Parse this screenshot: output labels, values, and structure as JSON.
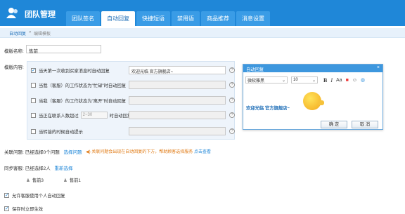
{
  "header": {
    "app_title": "团队管理",
    "tabs": [
      "团队签名",
      "自动回复",
      "快捷短语",
      "禁用语",
      "商品推荐",
      "消息设置"
    ],
    "active_tab": "自动回复"
  },
  "breadcrumb": {
    "root": "自动回复",
    "separator": "»",
    "current": "编辑模板"
  },
  "form": {
    "template_name_label": "模版名称:",
    "template_name_value": "售前",
    "content_label": "模版内容:"
  },
  "rules": [
    {
      "checked": true,
      "text": "当天第一次收到买家消息时自动回复",
      "reply": "欢迎光临      官方旗舰店~",
      "disabled": false
    },
    {
      "checked": false,
      "text": "当我（客服）的工作状态为\"忙碌\"时自动回复",
      "reply": "",
      "disabled": true
    },
    {
      "checked": false,
      "text": "当我（客服）的工作状态为\"离开\"时自动回复",
      "reply": "",
      "disabled": true
    },
    {
      "checked": false,
      "text_before": "当正在联系人数超过",
      "number_placeholder": "2~30",
      "text_after": "时自动回复",
      "reply": "",
      "disabled": true
    },
    {
      "checked": false,
      "text": "当转接的时候自动提示",
      "reply": "",
      "disabled": true
    }
  ],
  "help_glyph": "?",
  "dialog": {
    "title": "自动回复",
    "close": "×",
    "font_family": "微软雅黑",
    "font_size": "10",
    "toolbar_icons": [
      "bold-icon",
      "italic-icon",
      "font-size-icon",
      "color-icon",
      "emoji-icon",
      "globe-icon"
    ],
    "body_text": "欢迎光临      官方旗舰店~",
    "ok": "确 定",
    "cancel": "取 消"
  },
  "related_issues": {
    "label": "关联问题: 已经选择0个问题",
    "select_link": "选择问题",
    "notice": "关联问题会出现在自动回复的下方，帮助顾客选择服务",
    "notice_link": "点击查看"
  },
  "sync_service": {
    "label": "同步客服: 已经选择2人",
    "reselect_link": "重新选择",
    "members": [
      "售前3",
      "售前1"
    ]
  },
  "options": [
    {
      "checked": true,
      "label": "允许客服使用个人自动回复"
    },
    {
      "checked": true,
      "label": "保存时立即生效"
    }
  ]
}
